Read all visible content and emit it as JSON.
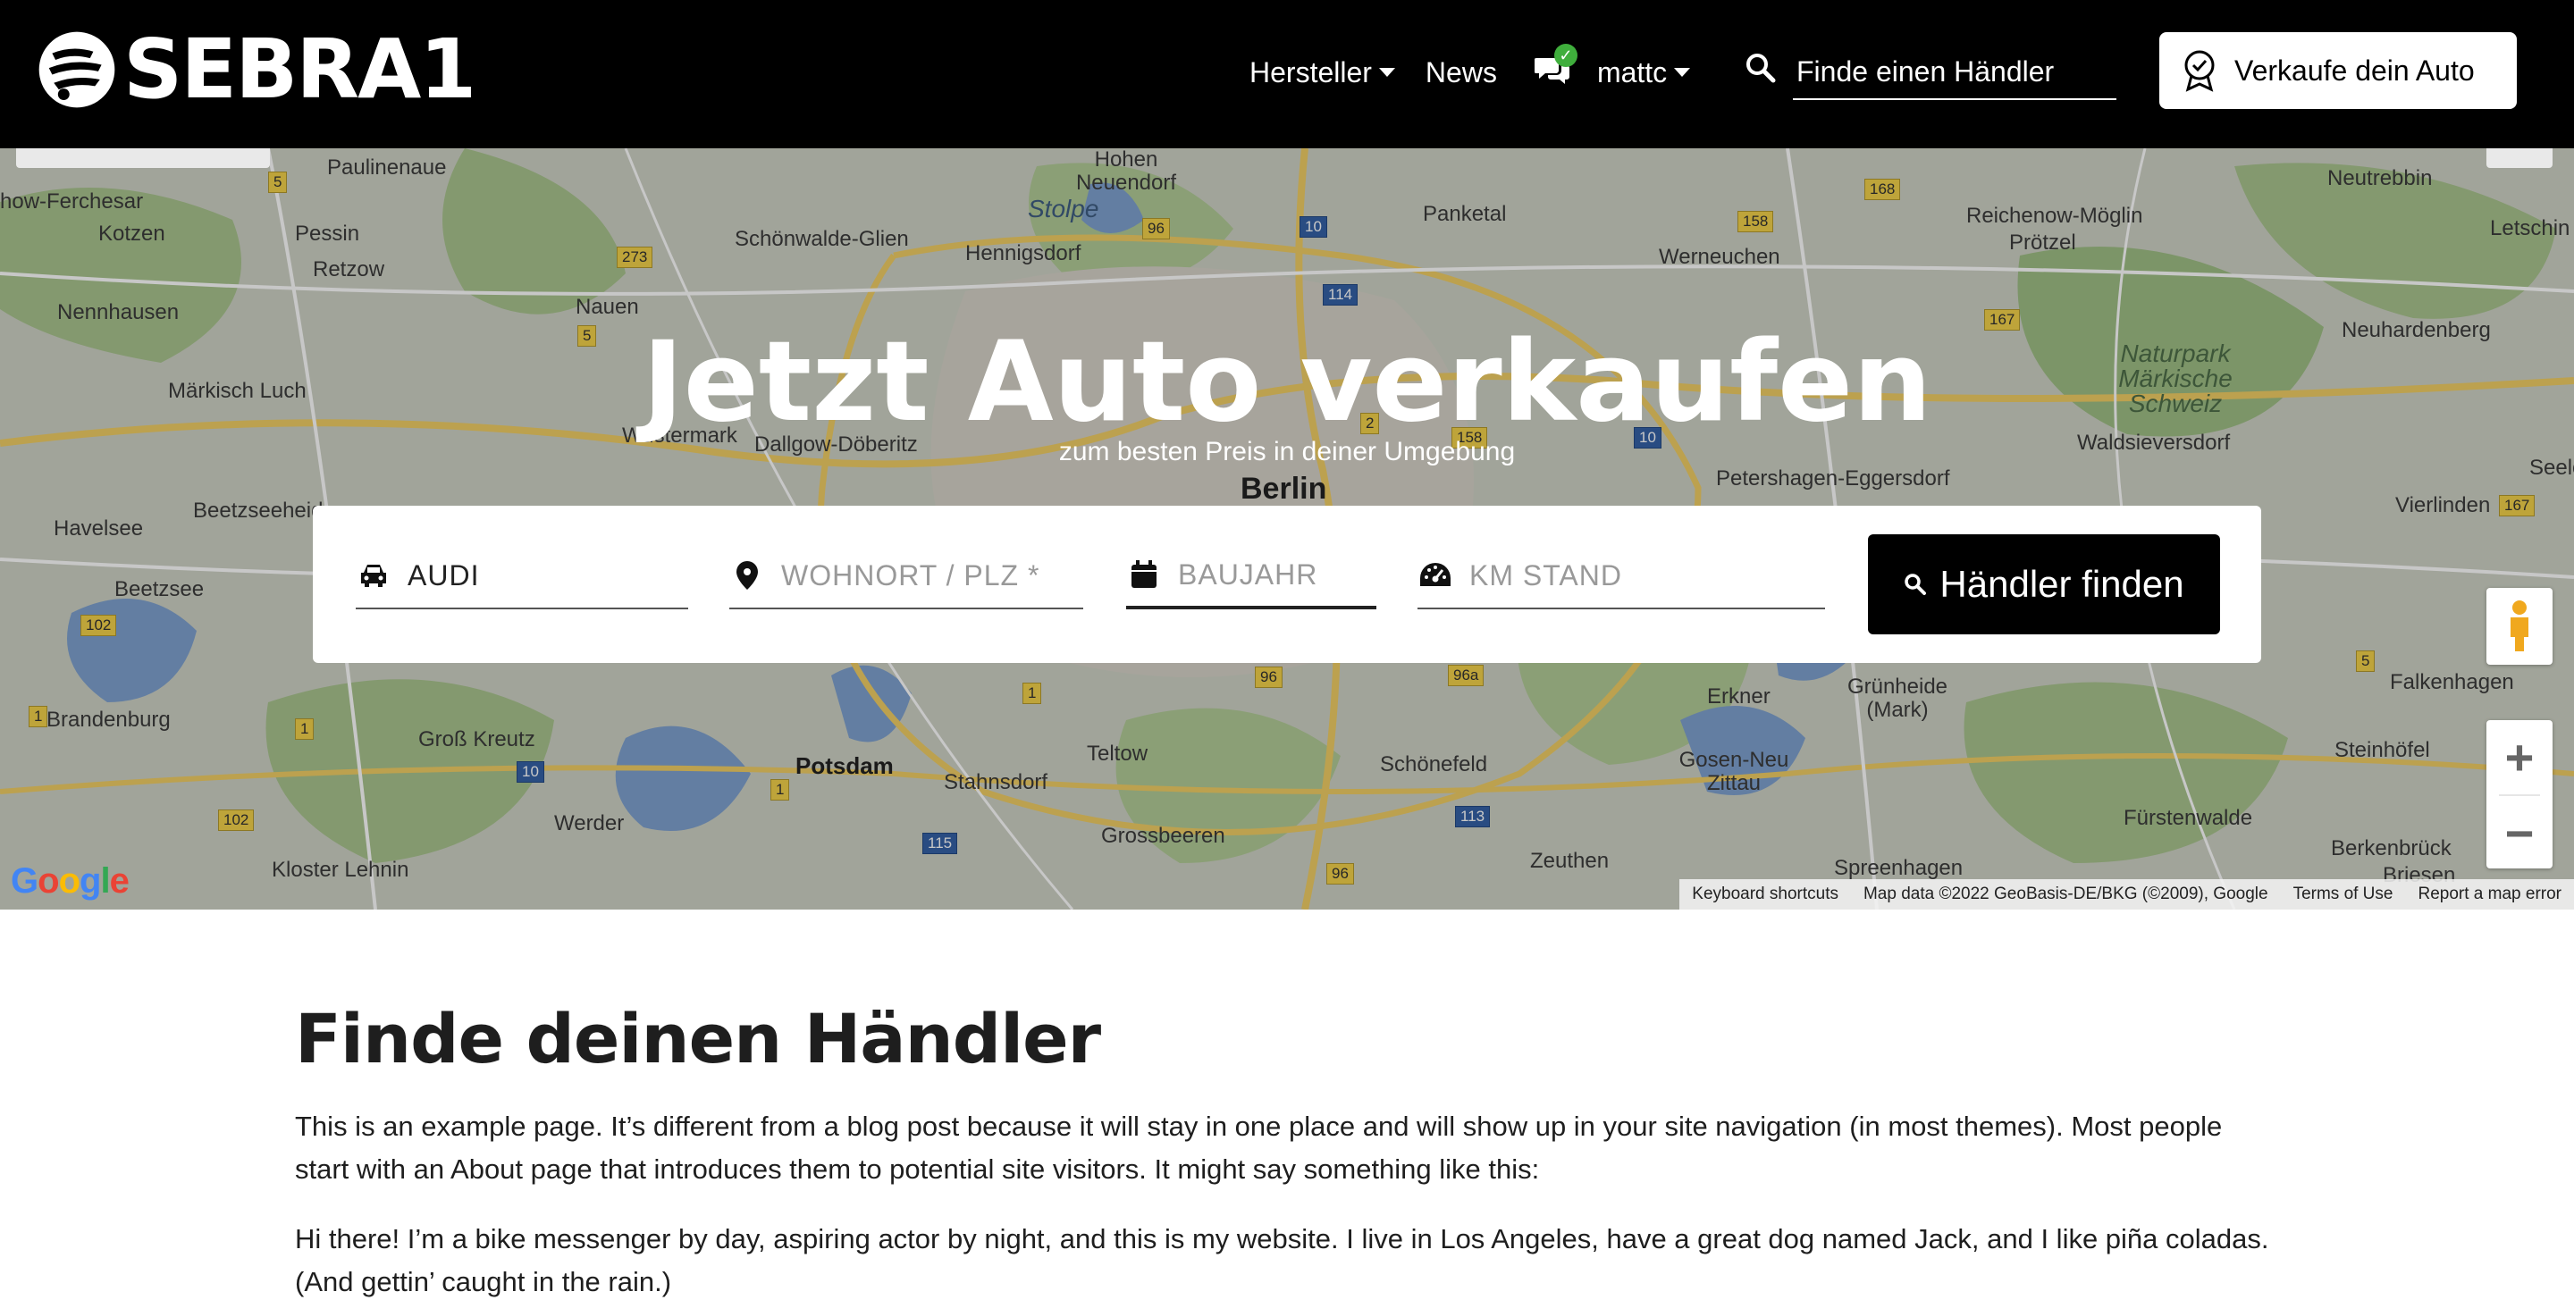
{
  "navbar": {
    "brand": "SEBRA1",
    "links": [
      {
        "label": "Hersteller",
        "dropdown": true
      },
      {
        "label": "News",
        "dropdown": false
      }
    ],
    "user": {
      "label": "mattc"
    },
    "search": {
      "placeholder": "Finde einen Händler"
    },
    "sell_button": "Verkaufe dein Auto"
  },
  "hero": {
    "title": "Jetzt Auto verkaufen",
    "subtitle": "zum besten Preis in deiner Umgebung",
    "fields": {
      "make": "AUDI",
      "location_placeholder": "WOHNORT / PLZ *",
      "year_placeholder": "BAUJAHR",
      "mileage_placeholder": "KM STAND"
    },
    "find_button": "Händler finden"
  },
  "map": {
    "labels": {
      "berlin": "Berlin",
      "potsdam": "Potsdam",
      "paulinenaue": "Paulinenaue",
      "ferchesar": "how-Ferchesar",
      "kotzen": "Kotzen",
      "pessin": "Pessin",
      "retzow": "Retzow",
      "nennhausen": "Nennhausen",
      "nauen": "Nauen",
      "maerkisch_luch": "Märkisch Luch",
      "schoenwalde": "Schönwalde-Glien",
      "hennigsdorf": "Hennigsdorf",
      "stolpe": "Stolpe",
      "hohen_neuendorf": "Hohen Neuendorf",
      "panketal": "Panketal",
      "werneuchen": "Werneuchen",
      "reichenow": "Reichenow-Möglin",
      "proetzel": "Prötzel",
      "neutrebbin": "Neutrebbin",
      "letschin": "Letschin",
      "neuhardenberg": "Neuhardenberg",
      "naturpark": "Naturpark Märkische Schweiz",
      "waldsieversdorf": "Waldsieversdorf",
      "petershagen": "Petershagen-Eggersdorf",
      "seelow": "Seelo",
      "vierlinden": "Vierlinden",
      "havelsee": "Havelsee",
      "beetzseeheide": "Beetzseeheid",
      "beetzsee": "Beetzsee",
      "wustermark": "Wustermark",
      "dallgow": "Dallgow-Döberitz",
      "brandenburg": "Brandenburg",
      "gross_kreutz": "Groß Kreutz",
      "werder": "Werder",
      "kloster_lehnin": "Kloster Lehnin",
      "teltow": "Teltow",
      "stahnsdorf": "Stahnsdorf",
      "grossbeeren": "Grossbeeren",
      "schoenefeld": "Schönefeld",
      "erkner": "Erkner",
      "gruenheide": "Grünheide (Mark)",
      "gosen": "Gosen-Neu Zittau",
      "zeuthen": "Zeuthen",
      "spreenhagen": "Spreenhagen",
      "fuerstenwalde": "Fürstenwalde",
      "berkenbrueck": "Berkenbrück",
      "steinhoefel": "Steinhöfel",
      "falkenhagen": "Falkenhagen",
      "briesen": "Briesen"
    },
    "google": "Google",
    "footer": {
      "shortcuts": "Keyboard shortcuts",
      "mapdata": "Map data ©2022 GeoBasis-DE/BKG (©2009), Google",
      "terms": "Terms of Use",
      "report": "Report a map error"
    }
  },
  "content": {
    "title": "Finde deinen Händler",
    "paragraphs": [
      "This is an example page. It’s different from a blog post because it will stay in one place and will show up in your site navigation (in most themes). Most people start with an About page that introduces them to potential site visitors. It might say something like this:",
      "Hi there! I’m a bike messenger by day, aspiring actor by night, and this is my website. I live in Los Angeles, have a great dog named Jack, and I like piña coladas. (And gettin’ caught in the rain.)"
    ]
  }
}
